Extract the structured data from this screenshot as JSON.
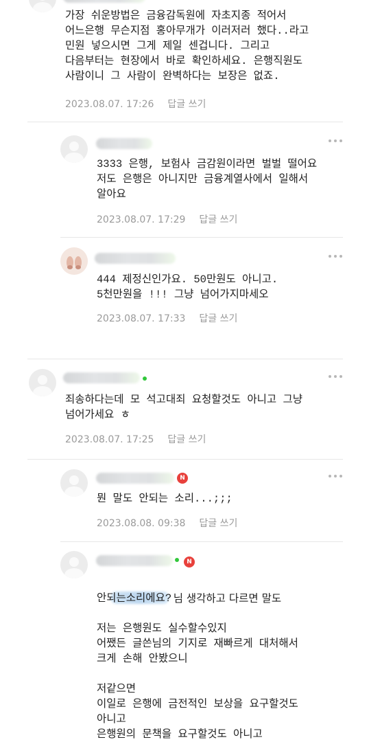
{
  "comments": [
    {
      "text": "가장 쉬운방법은 금융감독원에 자초지종 적어서\n어느은행 무슨지점 홍아무개가 이러저러 했다..라고\n민원 넣으시면 그게 제일 센겁니다. 그리고\n다음부터는 현장에서 바로 확인하세요. 은행직원도\n사람이니 그 사람이 완벽하다는 보장은 없죠.",
      "date": "2023.08.07. 17:26",
      "reply_label": "답글 쓰기"
    },
    {
      "text": "3333 은행, 보험사 금감원이라면 벌벌 떨어요\n저도 은행은 아니지만 금융계열사에서 일해서\n알아요",
      "date": "2023.08.07. 17:29",
      "reply_label": "답글 쓰기"
    },
    {
      "text": "444 제정신인가요. 50만원도 아니고.\n5천만원을 !!! 그냥 넘어가지마세오",
      "date": "2023.08.07. 17:33",
      "reply_label": "답글 쓰기"
    },
    {
      "text": "죄송하다는데 모 석고대죄 요청할것도 아니고 그냥\n넘어가세요 ㅎ",
      "date": "2023.08.07. 17:25",
      "reply_label": "답글 쓰기"
    },
    {
      "text": "뭔 말도 안되는 소리...;;;",
      "date": "2023.08.08. 09:38",
      "reply_label": "답글 쓰기",
      "badge": "N"
    },
    {
      "mention_suffix": "님 생각하고 다르면 말도",
      "text": "안되는소리에요?\n\n저는 은행원도 실수할수있지\n어쨌든 글쓴님의 기지로 재빠르게 대처해서\n크게 손해 안봤으니\n\n저같으면\n이일로 은행에 금전적인 보상을 요구할것도\n아니고\n은행원의 문책을 요구할것도 아니고",
      "badge": "N"
    }
  ],
  "icons": {
    "more": "more-options-icon",
    "avatar": "default-avatar-icon"
  },
  "colors": {
    "text": "#222222",
    "meta": "#9a9a9a",
    "badge": "#e8413c",
    "online": "#31c73b"
  }
}
